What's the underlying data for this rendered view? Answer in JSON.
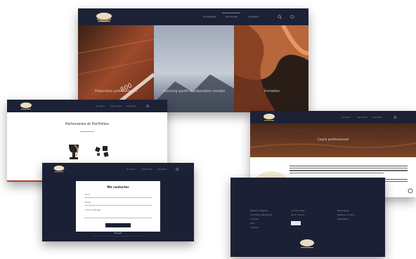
{
  "screens": {
    "top": {
      "nav": [
        "Stratégie",
        "Services",
        "Contact"
      ],
      "panels": [
        {
          "caption": "Préparation professionnelle"
        },
        {
          "caption": "Coaching sportif et préparation mentale"
        },
        {
          "caption": "Formation"
        }
      ]
    },
    "left": {
      "nav": [
        "Accueil",
        "Services",
        "Contact"
      ],
      "heading": "Partenaires et Portfolios"
    },
    "contact": {
      "nav": [
        "Accueil",
        "Services",
        "Contact"
      ],
      "title": "Me contacter",
      "fields": [
        "Nom",
        "Email",
        "Votre message"
      ],
      "button": "Envoyer"
    },
    "right": {
      "nav": [
        "Accueil",
        "Services",
        "Contact"
      ],
      "hero_title": "Coach professionnel"
    },
    "footer": {
      "columns": [
        [
          "Mentions légales",
          "Conditions générales",
          "Cookies",
          "Plan",
          "Contact"
        ],
        [
          "Coordonnées",
          "Paris, France"
        ],
        [
          "Partenaires",
          "Réseaux sociaux",
          "Newsletter"
        ]
      ]
    }
  },
  "colors": {
    "navy": "#1c2035",
    "gold": "#c9a24a"
  }
}
